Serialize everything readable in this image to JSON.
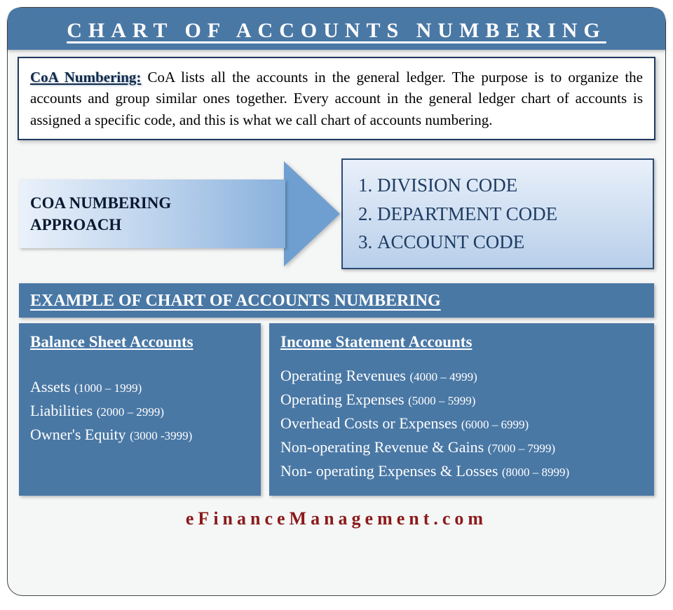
{
  "title": "CHART OF ACCOUNTS NUMBERING",
  "intro": {
    "lead": "CoA Numbering:",
    "body": " CoA lists all the accounts in the general ledger. The purpose is to organize the accounts and group similar ones together. Every account in the general ledger chart of accounts is assigned a specific code, and this is what we call chart of accounts numbering."
  },
  "approach": {
    "arrow_label_line1": "COA NUMBERING",
    "arrow_label_line2": "APPROACH",
    "codes": [
      "DIVISION CODE",
      "DEPARTMENT CODE",
      "ACCOUNT CODE"
    ]
  },
  "example_header": "EXAMPLE OF CHART OF ACCOUNTS NUMBERING",
  "balance_sheet": {
    "title": "Balance Sheet Accounts",
    "items": [
      {
        "name": "Assets",
        "range": "(1000 – 1999)"
      },
      {
        "name": "Liabilities",
        "range": "(2000 – 2999)"
      },
      {
        "name": "Owner's Equity",
        "range": "(3000 -3999)"
      }
    ]
  },
  "income_statement": {
    "title": "Income Statement Accounts",
    "items": [
      {
        "name": "Operating Revenues",
        "range": "(4000 – 4999)"
      },
      {
        "name": "Operating Expenses",
        "range": "(5000 – 5999)"
      },
      {
        "name": "Overhead Costs or Expenses",
        "range": "(6000 – 6999)"
      },
      {
        "name": "Non-operating Revenue & Gains",
        "range": "(7000 – 7999)"
      },
      {
        "name": "Non- operating Expenses & Losses",
        "range": "(8000 – 8999)"
      }
    ]
  },
  "footer": "eFinanceManagement.com"
}
